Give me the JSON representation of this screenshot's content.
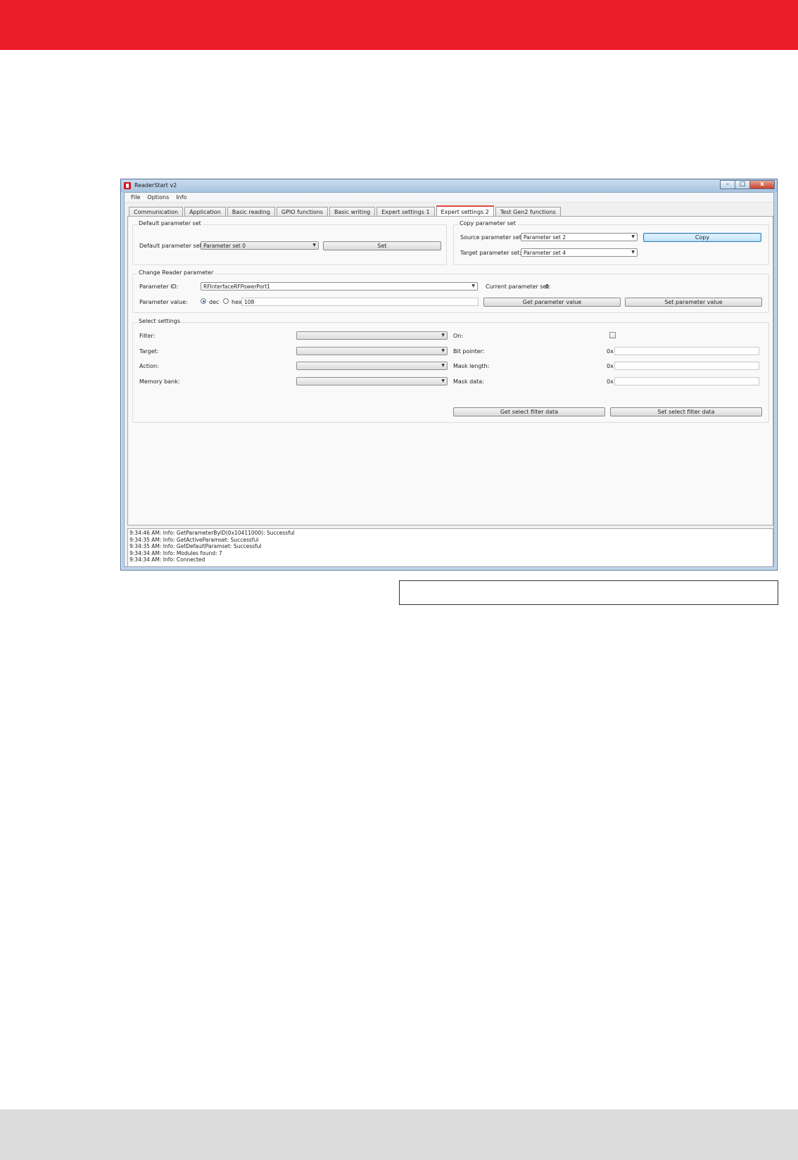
{
  "window": {
    "title": "ReaderStart v2",
    "controls": {
      "minimize": "–",
      "maximize": "□",
      "close": "x"
    }
  },
  "menu": [
    "File",
    "Options",
    "Info"
  ],
  "tabs": [
    {
      "label": "Communication"
    },
    {
      "label": "Application"
    },
    {
      "label": "Basic reading"
    },
    {
      "label": "GPIO functions"
    },
    {
      "label": "Basic writing"
    },
    {
      "label": "Expert settings 1"
    },
    {
      "label": "Expert settings 2",
      "active": true
    },
    {
      "label": "Test Gen2 functions"
    }
  ],
  "default_param": {
    "group_title": "Default parameter set",
    "label": "Default parameter set:",
    "selected": "Parameter set 0",
    "set_button": "Set"
  },
  "copy_param": {
    "group_title": "Copy parameter set",
    "source_label": "Source parameter set:",
    "source_selected": "Parameter set 2",
    "target_label": "Target parameter set:",
    "target_selected": "Parameter set 4",
    "copy_button": "Copy"
  },
  "change_param": {
    "group_title": "Change Reader parameter",
    "id_label": "Parameter ID:",
    "id_selected": "RFInterfaceRFPowerPort1",
    "current_set_label": "Current parameter set:",
    "current_set_value": "0",
    "value_label": "Parameter value:",
    "dec_label": "dec",
    "hex_label": "hex",
    "value": "108",
    "get_button": "Get parameter value",
    "set_button": "Set parameter value"
  },
  "select_settings": {
    "group_title": "Select settings",
    "filter_label": "Filter:",
    "target_label": "Target:",
    "action_label": "Action:",
    "memory_bank_label": "Memory bank:",
    "on_label": "On:",
    "bit_pointer_label": "Bit pointer:",
    "mask_length_label": "Mask length:",
    "mask_data_label": "Mask data:",
    "hex_prefix": "0x",
    "get_button": "Get select filter data",
    "set_button": "Set select filter data"
  },
  "log": [
    "9:34:46 AM: Info: GetParameterByID(0x10411000): Successful",
    "9:34:35 AM: Info: GetActiveParamset: Successful",
    "9:34:35 AM: Info: GetDefaultParamset: Successful",
    "9:34:34 AM: Info: Modules found: 7",
    "9:34:34 AM: Info: Connected"
  ],
  "colors": {
    "brand_red": "#ed1c29",
    "footer_gray": "#dcdcdc",
    "window_frame": "#b9d1ea"
  }
}
